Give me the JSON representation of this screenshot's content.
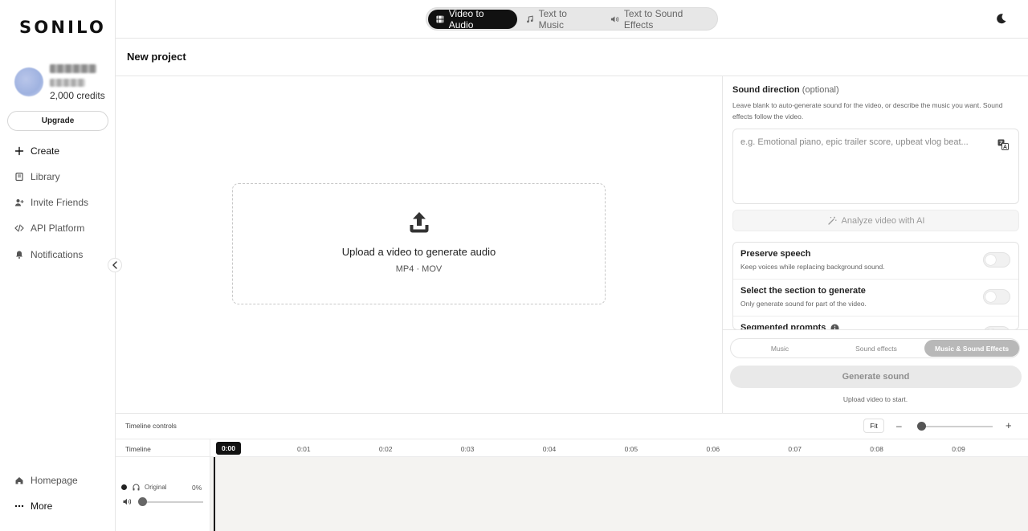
{
  "app": {
    "logo": "SONILO"
  },
  "user": {
    "credits": "2,000 credits",
    "upgrade_label": "Upgrade"
  },
  "sidebar": {
    "items": [
      {
        "label": "Create",
        "icon": "plus-icon"
      },
      {
        "label": "Library",
        "icon": "book-icon"
      },
      {
        "label": "Invite Friends",
        "icon": "user-plus-icon"
      },
      {
        "label": "API Platform",
        "icon": "code-icon"
      },
      {
        "label": "Notifications",
        "icon": "bell-icon"
      }
    ],
    "bottom_items": [
      {
        "label": "Homepage",
        "icon": "home-icon"
      },
      {
        "label": "More",
        "icon": "dots-icon"
      }
    ]
  },
  "mode_tabs": [
    {
      "label": "Video to Audio",
      "icon": "film-icon",
      "active": true
    },
    {
      "label": "Text to Music",
      "icon": "music-note-icon",
      "active": false
    },
    {
      "label": "Text to Sound Effects",
      "icon": "speaker-icon",
      "active": false
    }
  ],
  "project": {
    "title": "New project"
  },
  "upload": {
    "title": "Upload a video to generate audio",
    "formats": "MP4 · MOV"
  },
  "sound_direction": {
    "title": "Sound direction",
    "optional": "(optional)",
    "description": "Leave blank to auto-generate sound for the video, or describe the music you want. Sound effects follow the video.",
    "placeholder": "e.g. Emotional piano, epic trailer score, upbeat vlog beat...",
    "analyze_label": "Analyze video with AI"
  },
  "options": [
    {
      "title": "Preserve speech",
      "description": "Keep voices while replacing background sound.",
      "enabled": false
    },
    {
      "title": "Select the section to generate",
      "description": "Only generate sound for part of the video.",
      "enabled": false
    },
    {
      "title": "Segmented prompts",
      "description": "",
      "enabled": false
    }
  ],
  "sound_type": {
    "tabs": [
      "Music",
      "Sound effects",
      "Music & Sound Effects"
    ],
    "active": "Music & Sound Effects"
  },
  "generate": {
    "label": "Generate sound",
    "hint": "Upload video to start."
  },
  "timeline": {
    "controls_label": "Timeline controls",
    "fit_label": "Fit",
    "zoom_out": "–",
    "zoom_in": "+",
    "label": "Timeline",
    "ticks": [
      "0:00",
      "0:01",
      "0:02",
      "0:03",
      "0:04",
      "0:05",
      "0:06",
      "0:07",
      "0:08",
      "0:09"
    ],
    "current_time": "0:00",
    "zoom_level": 0,
    "track": {
      "name": "Original",
      "percent": "0%",
      "volume": 0
    }
  }
}
